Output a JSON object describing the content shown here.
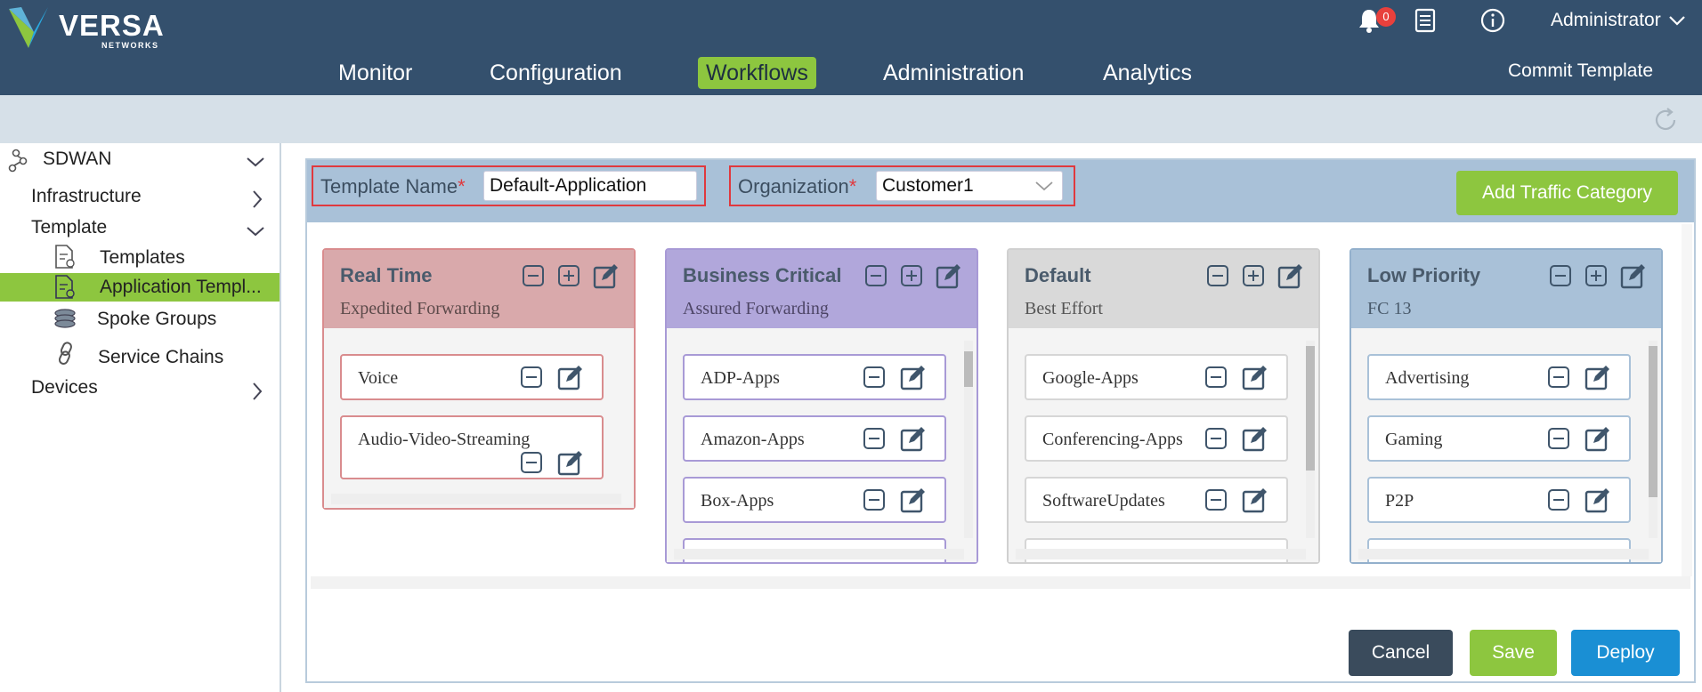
{
  "brand": {
    "name": "VERSA",
    "sub": "NETWORKS"
  },
  "header": {
    "nav": [
      "Monitor",
      "Configuration",
      "Workflows",
      "Administration",
      "Analytics"
    ],
    "commit_label": "Commit Template",
    "notifications_count": "0",
    "user": "Administrator",
    "colors": {
      "bar": "#34506d",
      "active": "#8dc63f"
    }
  },
  "sidebar": {
    "root": "SDWAN",
    "items": [
      "Infrastructure",
      "Template",
      "Templates",
      "Application Templ...",
      "Spoke Groups",
      "Service Chains",
      "Devices"
    ]
  },
  "form": {
    "template_name_label": "Template Name",
    "template_name_value": "Default-Application",
    "organization_label": "Organization",
    "organization_value": "Customer1",
    "required_mark": "*",
    "add_category_label": "Add Traffic Category"
  },
  "categories": [
    {
      "title": "Real Time",
      "subtitle": "Expedited Forwarding",
      "apps": [
        "Voice",
        "Audio-Video-Streaming"
      ]
    },
    {
      "title": "Business Critical",
      "subtitle": "Assured Forwarding",
      "apps": [
        "ADP-Apps",
        "Amazon-Apps",
        "Box-Apps"
      ]
    },
    {
      "title": "Default",
      "subtitle": "Best Effort",
      "apps": [
        "Google-Apps",
        "Conferencing-Apps",
        "SoftwareUpdates"
      ]
    },
    {
      "title": "Low Priority",
      "subtitle": "FC 13",
      "apps": [
        "Advertising",
        "Gaming",
        "P2P"
      ]
    }
  ],
  "actions": {
    "cancel": "Cancel",
    "save": "Save",
    "deploy": "Deploy"
  }
}
